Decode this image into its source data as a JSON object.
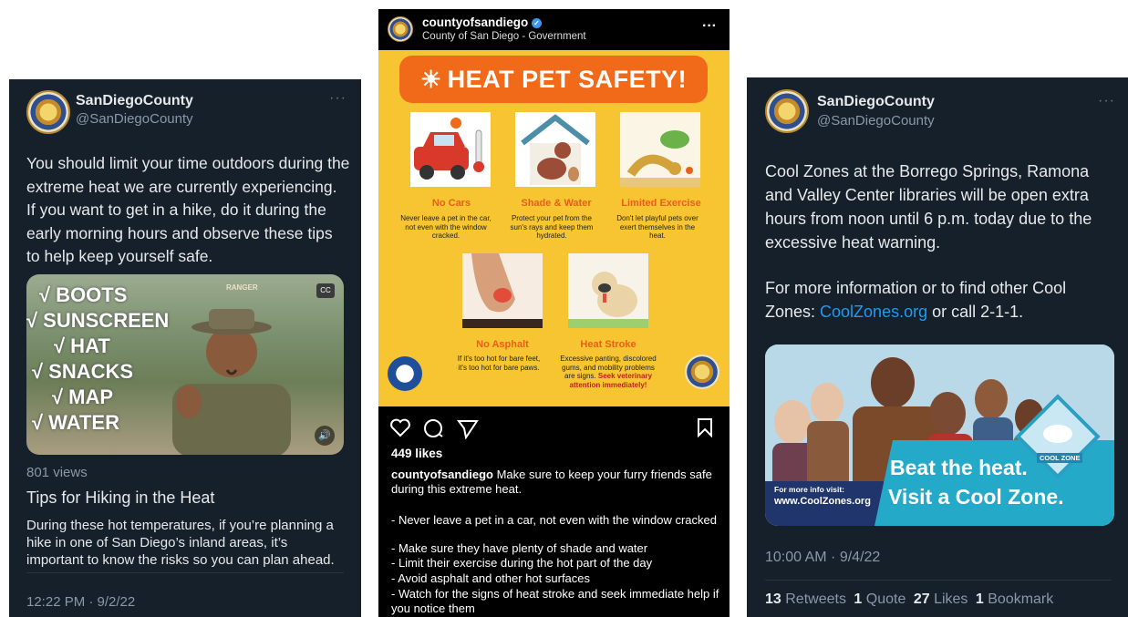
{
  "tweet1": {
    "name": "SanDiegoCounty",
    "handle": "@SanDiegoCounty",
    "more": "···",
    "text": "You should limit your time outdoors during the extreme heat we are currently experiencing. If you want to get in a hike, do it during the early morning hours and observe these tips to help keep yourself safe.",
    "video": {
      "items": [
        "√ BOOTS",
        "√ SUNSCREEN",
        "√ HAT",
        "√ SNACKS",
        "√ MAP",
        "√ WATER"
      ],
      "cc_label": "CC",
      "hat_text": "RANGER"
    },
    "views": "801 views",
    "card_title": "Tips for Hiking in the Heat",
    "card_desc": "During these hot temperatures, if you’re planning a hike in one of San Diego’s inland areas, it’s important to know the risks so you can plan ahead.",
    "timestamp": "12:22 PM · 9/2/22"
  },
  "instagram": {
    "username": "countyofsandiego",
    "subtitle": "County of San Diego - Government",
    "more": "···",
    "poster": {
      "title": "HEAT PET SAFETY!",
      "cards": [
        {
          "title": "No Cars",
          "text": "Never leave a pet in the car, not even with the window cracked."
        },
        {
          "title": "Shade & Water",
          "text": "Protect your pet from the sun's rays and keep them hydrated."
        },
        {
          "title": "Limited Exercise",
          "text": "Don't let playful pets over exert themselves in the heat."
        },
        {
          "title": "No Asphalt",
          "text": "If it's too hot for bare feet, it's too hot for bare paws."
        },
        {
          "title": "Heat Stroke",
          "text": "Excessive panting, discolored gums, and mobility problems are signs.",
          "emph": "Seek veterinary attention immediately!"
        }
      ]
    },
    "likes": "449 likes",
    "caption_user": "countyofsandiego",
    "caption": "Make sure to keep your furry friends safe during this extreme heat.",
    "bullets": [
      "- Never leave a pet in a car, not even with the window cracked",
      "- Make sure they have plenty of shade and water",
      "- Limit their exercise during the hot part of the day",
      "- Avoid asphalt and other hot surfaces",
      "- Watch for the signs of heat stroke and seek immediate help if you notice them"
    ]
  },
  "tweet2": {
    "name": "SanDiegoCounty",
    "handle": "@SanDiegoCounty",
    "more": "···",
    "text1": "Cool Zones at the Borrego Springs, Ramona and Valley Center libraries will be open extra hours from noon until 6 p.m. today due to the excessive heat warning.",
    "text2_pre": "For more information or to find other Cool Zones: ",
    "text2_link": "CoolZones.org",
    "text2_post": " or call 2-1-1.",
    "image": {
      "badge": "COOL ZONE",
      "headline1": "Beat the heat.",
      "headline2": "Visit a Cool Zone.",
      "info_label": "For more info visit:",
      "info_url": "www.CoolZones.org"
    },
    "timestamp": "10:00 AM · 9/4/22",
    "stats": {
      "retweets_count": "13",
      "retweets_label": "Retweets",
      "quote_count": "1",
      "quote_label": "Quote",
      "likes_count": "27",
      "likes_label": "Likes",
      "bookmark_count": "1",
      "bookmark_label": "Bookmark"
    }
  }
}
